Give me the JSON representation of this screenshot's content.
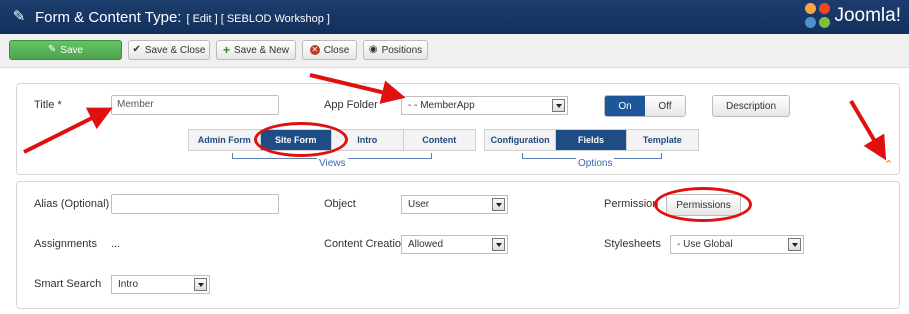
{
  "header": {
    "title": "Form & Content Type:",
    "subtitle": "[ Edit ] [ SEBLOD Workshop ]",
    "brand": "Joomla!"
  },
  "toolbar": {
    "save": "Save",
    "save_close": "Save & Close",
    "save_new": "Save & New",
    "close": "Close",
    "positions": "Positions"
  },
  "main": {
    "title_label": "Title *",
    "title_value": "Member",
    "app_folder_label": "App Folder",
    "app_folder_value": "- - MemberApp",
    "toggle_on": "On",
    "toggle_off": "Off",
    "description_button": "Description",
    "views_tabs": [
      "Admin Form",
      "Site Form",
      "Intro",
      "Content"
    ],
    "options_tabs": [
      "Configuration",
      "Fields",
      "Template"
    ],
    "views_label": "Views",
    "options_label": "Options"
  },
  "settings": {
    "alias_label": "Alias (Optional)",
    "alias_value": "",
    "object_label": "Object",
    "object_value": "User",
    "permission_label": "Permission",
    "permissions_button": "Permissions",
    "assignments_label": "Assignments",
    "assignments_value": "...",
    "content_creation_label": "Content Creation",
    "content_creation_value": "Allowed",
    "stylesheets_label": "Stylesheets",
    "stylesheets_value": "- Use Global",
    "smart_search_label": "Smart Search",
    "smart_search_value": "Intro"
  },
  "colors": {
    "header_bg": "#1a3867",
    "accent": "#1e4d86",
    "save_green": "#51a351",
    "annotation_red": "#e01010"
  },
  "icons": {
    "header": "pencil-icon",
    "save": "save-icon",
    "save_close": "check-icon",
    "save_new": "plus-icon",
    "close": "close-icon",
    "positions": "eye-icon",
    "collapse": "chevron-up-icon"
  }
}
